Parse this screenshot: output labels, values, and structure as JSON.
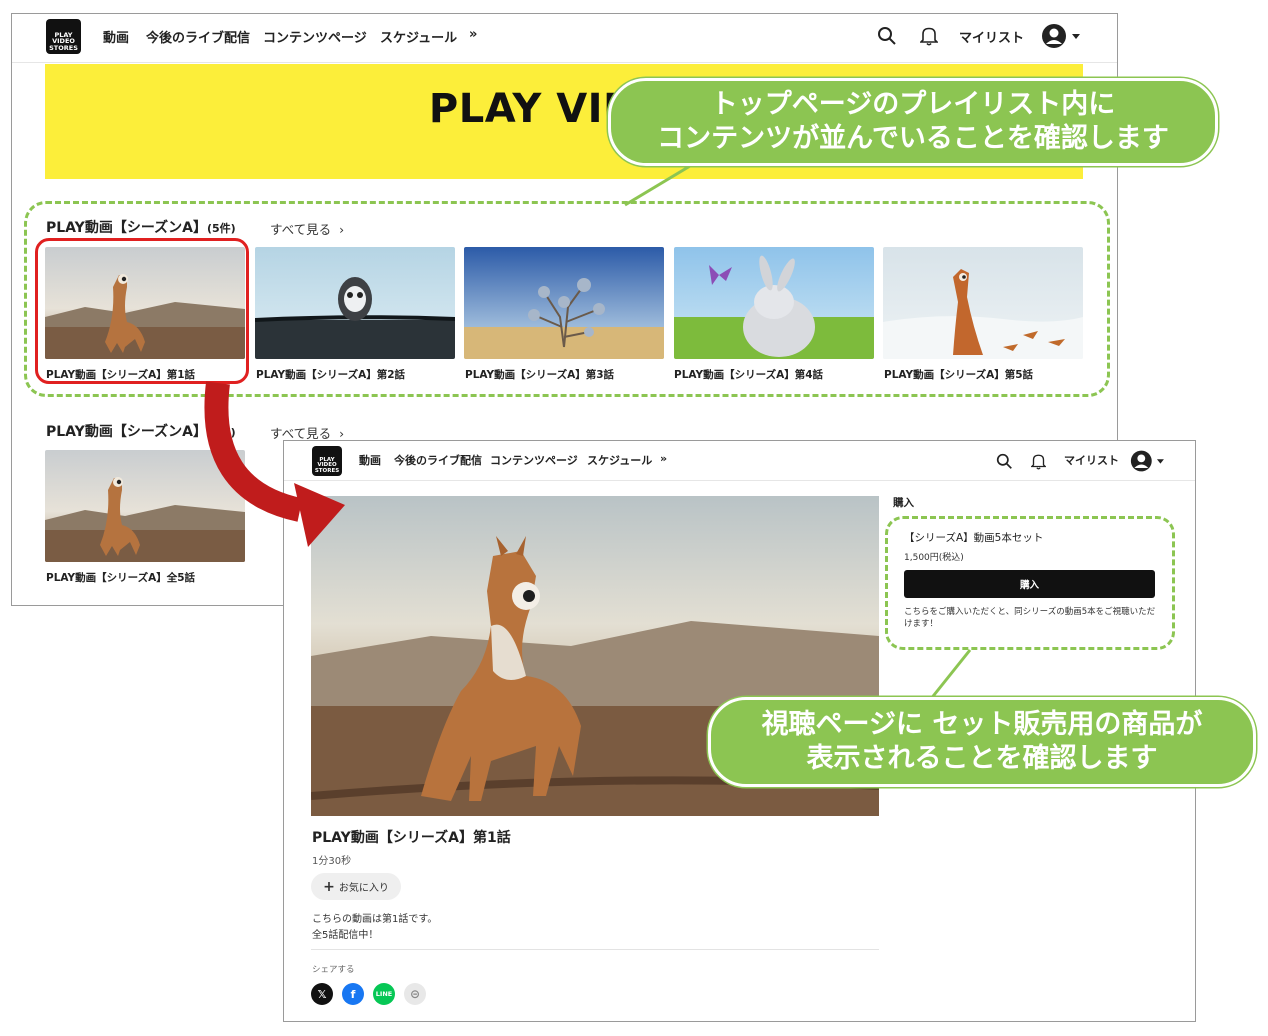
{
  "header": {
    "logo_text": [
      "PLAY",
      "VIDEO",
      "STORES"
    ],
    "nav": [
      "動画",
      "今後のライブ配信",
      "コンテンツページ",
      "スケジュール"
    ],
    "more": "»",
    "mylist": "マイリスト"
  },
  "top_page": {
    "banner_title": "PLAY VIDEO",
    "section1": {
      "title": "PLAY動画【シーズンA】",
      "count": "(5件)",
      "see_all": "すべて見る",
      "items": [
        "PLAY動画【シリーズA】第1話",
        "PLAY動画【シリーズA】第2話",
        "PLAY動画【シリーズA】第3話",
        "PLAY動画【シリーズA】第4話",
        "PLAY動画【シリーズA】第5話"
      ]
    },
    "section2": {
      "title": "PLAY動画【シーズンA】",
      "count": "(1件)",
      "see_all": "すべて見る",
      "items": [
        "PLAY動画【シリーズA】全5話"
      ]
    }
  },
  "watch_page": {
    "video_title": "PLAY動画【シリーズA】第1話",
    "duration": "1分30秒",
    "favorite": "お気に入り",
    "description": [
      "こちらの動画は第1話です。",
      "全5話配信中！"
    ],
    "share_label": "シェアする",
    "share_icons": [
      "x-icon",
      "facebook-icon",
      "line-icon",
      "link-icon"
    ],
    "purchase": {
      "heading": "購入",
      "product": "【シリーズA】動画5本セット",
      "price": "1,500円(税込)",
      "buy": "購入",
      "note": "こちらをご購入いただくと、同シリーズの動画5本をご視聴いただけます！"
    }
  },
  "callouts": {
    "top": [
      "トップページのプレイリスト内に",
      "コンテンツが並んでいることを確認します"
    ],
    "bottom": [
      "視聴ページに セット販売用の商品が",
      "表示されることを確認します"
    ]
  },
  "colors": {
    "callout_green": "#8cc552",
    "highlight_red": "#e02020",
    "arrow_red": "#c01c1c",
    "banner_yellow": "#fcee3a"
  }
}
